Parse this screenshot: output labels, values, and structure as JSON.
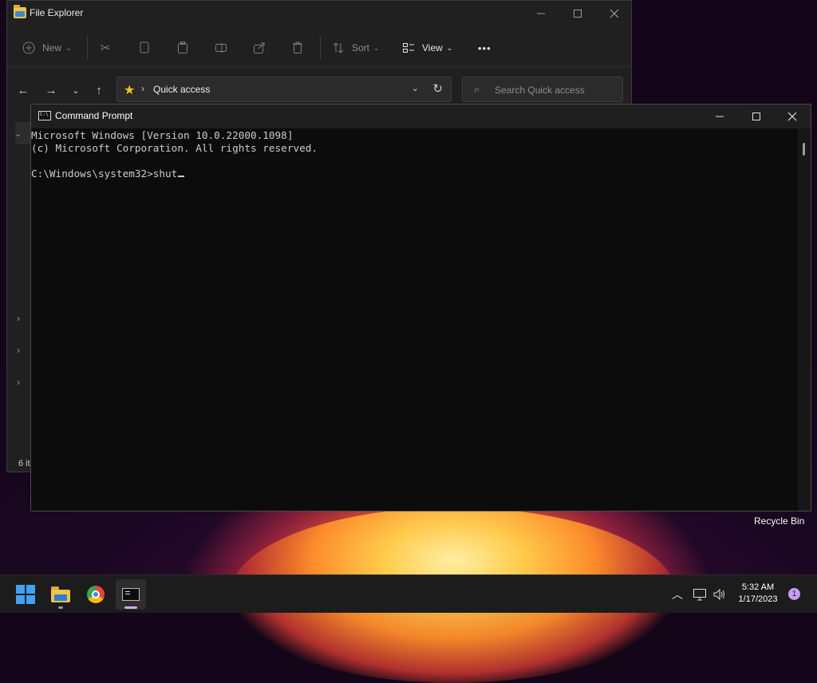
{
  "desktop": {
    "recycle_bin_label": "Recycle Bin"
  },
  "explorer": {
    "title": "File Explorer",
    "toolbar": {
      "new_label": "New",
      "sort_label": "Sort",
      "view_label": "View",
      "more": "•••"
    },
    "address": {
      "location": "Quick access",
      "search_placeholder": "Search Quick access"
    },
    "status_text": "6 it"
  },
  "cmd": {
    "title": "Command Prompt",
    "lines": [
      "Microsoft Windows [Version 10.0.22000.1098]",
      "(c) Microsoft Corporation. All rights reserved.",
      "",
      "C:\\Windows\\system32>shut"
    ]
  },
  "taskbar": {
    "clock_time": "5:32 AM",
    "clock_date": "1/17/2023",
    "notification_count": "1"
  },
  "colors": {
    "accent": "#3ea3f5",
    "cmd_text": "#cccccc",
    "active_indicator": "#d7a7ff"
  }
}
